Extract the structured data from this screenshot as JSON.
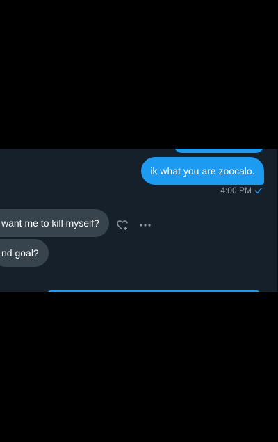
{
  "conversation": {
    "messages": [
      {
        "direction": "outgoing",
        "text": "ik what you are zoocalo.",
        "time": "4:00 PM"
      },
      {
        "direction": "incoming",
        "text": "want me to kill myself?"
      },
      {
        "direction": "incoming",
        "text": "nd goal?"
      }
    ]
  },
  "icons": {
    "read_receipt": "check-icon",
    "react": "heart-plus-icon",
    "more": "more-icon"
  },
  "colors": {
    "background": "#000000",
    "panel": "#15202b",
    "outgoing_bubble": "#1d9bf0",
    "incoming_bubble": "#38444d",
    "meta_text": "#8b98a5"
  }
}
